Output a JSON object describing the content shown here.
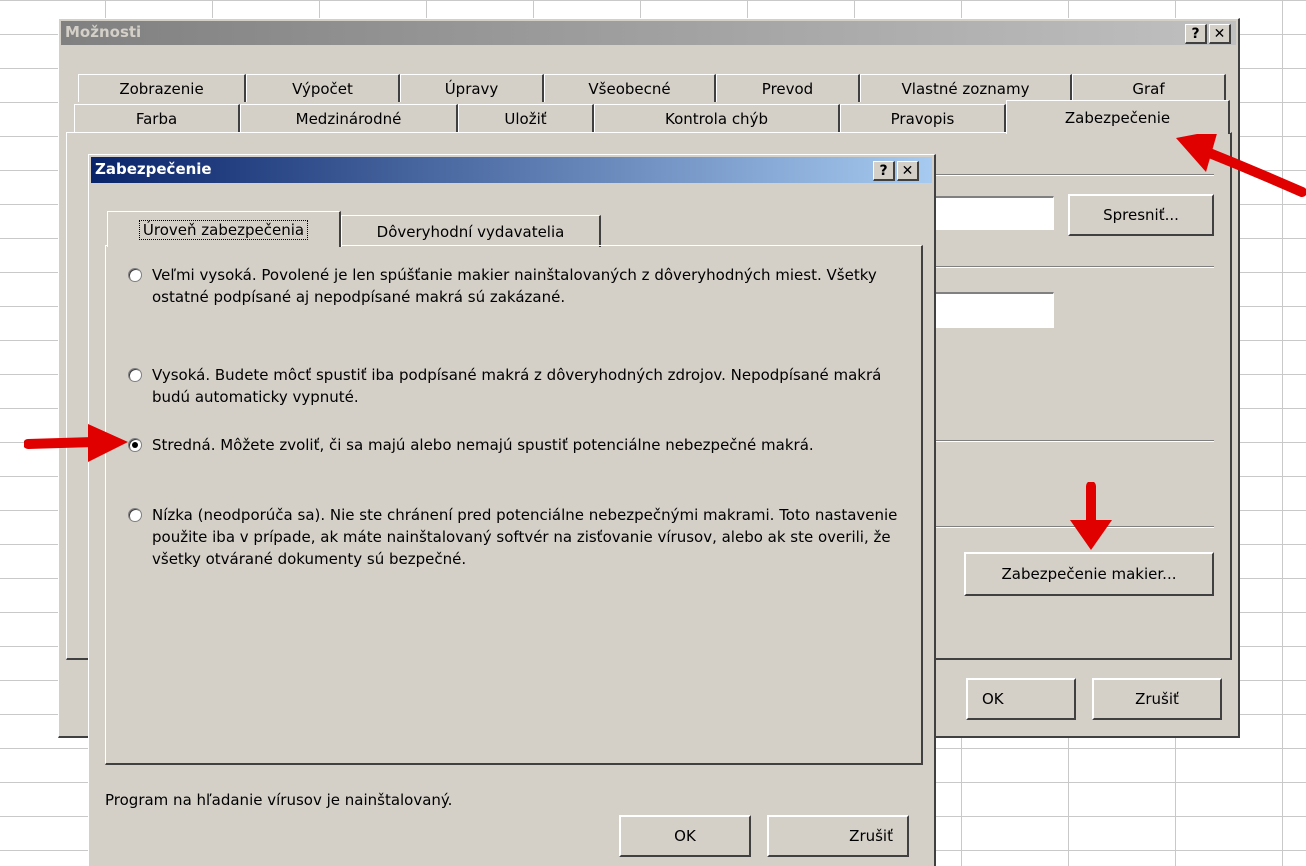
{
  "outer_dialog": {
    "title": "Možnosti",
    "help_label": "?",
    "close_label": "✕",
    "tabs_row1": [
      "Zobrazenie",
      "Výpočet",
      "Úpravy",
      "Všeobecné",
      "Prevod",
      "Vlastné zoznamy",
      "Graf"
    ],
    "tabs_row2": [
      "Farba",
      "Medzinárodné",
      "Uložiť",
      "Kontrola chýb",
      "Pravopis",
      "Zabezpečenie"
    ],
    "active_tab": "Zabezpečenie",
    "advanced_button": "Spresniť...",
    "macro_security_button": "Zabezpečenie makier...",
    "ok_label": "OK",
    "cancel_label": "Zrušiť"
  },
  "inner_dialog": {
    "title": "Zabezpečenie",
    "help_label": "?",
    "close_label": "✕",
    "tabs": [
      "Úroveň zabezpečenia",
      "Dôveryhodní vydavatelia"
    ],
    "active_tab": "Úroveň zabezpečenia",
    "options": [
      {
        "label": "Veľmi vysoká. Povolené je len spúšťanie makier nainštalovaných z dôveryhodných miest. Všetky ostatné podpísané aj nepodpísané makrá sú zakázané.",
        "checked": false
      },
      {
        "label": "Vysoká. Budete môcť spustiť iba podpísané makrá z dôveryhodných zdrojov. Nepodpísané makrá budú automaticky vypnuté.",
        "checked": false
      },
      {
        "label": "Stredná. Môžete zvoliť, či sa majú alebo nemajú spustiť potenciálne nebezpečné makrá.",
        "checked": true
      },
      {
        "label": "Nízka (neodporúča sa). Nie ste chránení pred potenciálne nebezpečnými makrami. Toto nastavenie použite iba v prípade, ak máte nainštalovaný softvér na zisťovanie vírusov, alebo ak ste overili, že všetky otvárané dokumenty sú bezpečné.",
        "checked": false
      }
    ],
    "status_text": "Program na hľadanie vírusov je nainštalovaný.",
    "ok_label": "OK",
    "cancel_label": "Zrušiť"
  },
  "colors": {
    "dialog_face": "#d4d0c8",
    "active_title": "#0a246a",
    "inactive_title": "#808080",
    "annotation_arrow": "#e00000"
  }
}
